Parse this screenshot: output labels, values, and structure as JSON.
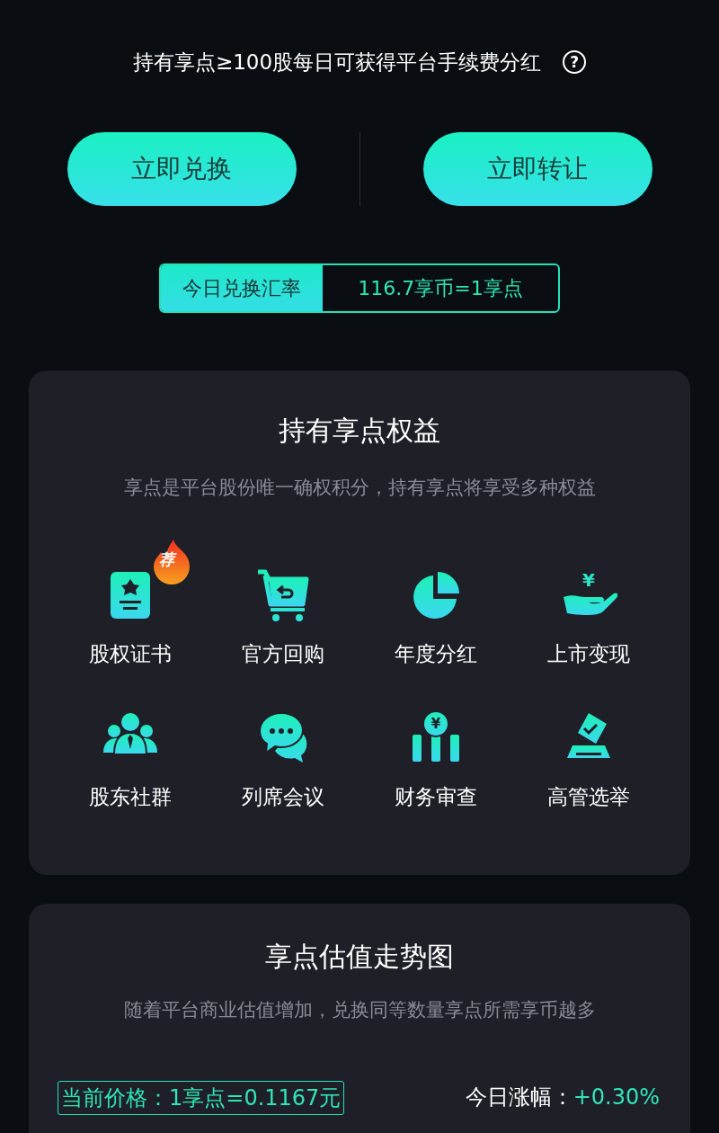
{
  "notice": {
    "text": "持有享点≥100股每日可获得平台手续费分红",
    "help": "?"
  },
  "actions": [
    {
      "label": "立即兑换"
    },
    {
      "label": "立即转让"
    }
  ],
  "rate": {
    "label": "今日兑换汇率",
    "value": "116.7享币=1享点"
  },
  "benefits": {
    "title": "持有享点权益",
    "subtitle": "享点是平台股份唯一确权积分，持有享点将享受多种权益",
    "items": [
      {
        "label": "股权证书",
        "kind": "certificate",
        "badge": "荐"
      },
      {
        "label": "官方回购",
        "kind": "cart"
      },
      {
        "label": "年度分红",
        "kind": "pie"
      },
      {
        "label": "上市变现",
        "kind": "hand",
        "icon_text": "¥"
      },
      {
        "label": "股东社群",
        "kind": "people"
      },
      {
        "label": "列席会议",
        "kind": "chat"
      },
      {
        "label": "财务审查",
        "kind": "bars",
        "icon_text": "¥"
      },
      {
        "label": "高管选举",
        "kind": "ballot"
      }
    ]
  },
  "trend": {
    "title": "享点估值走势图",
    "subtitle": "随着平台商业估值增加，兑换同等数量享点所需享币越多",
    "price": "当前价格：1享点=0.1167元",
    "change_label": "今日涨幅：",
    "change_value": "+0.30%"
  }
}
